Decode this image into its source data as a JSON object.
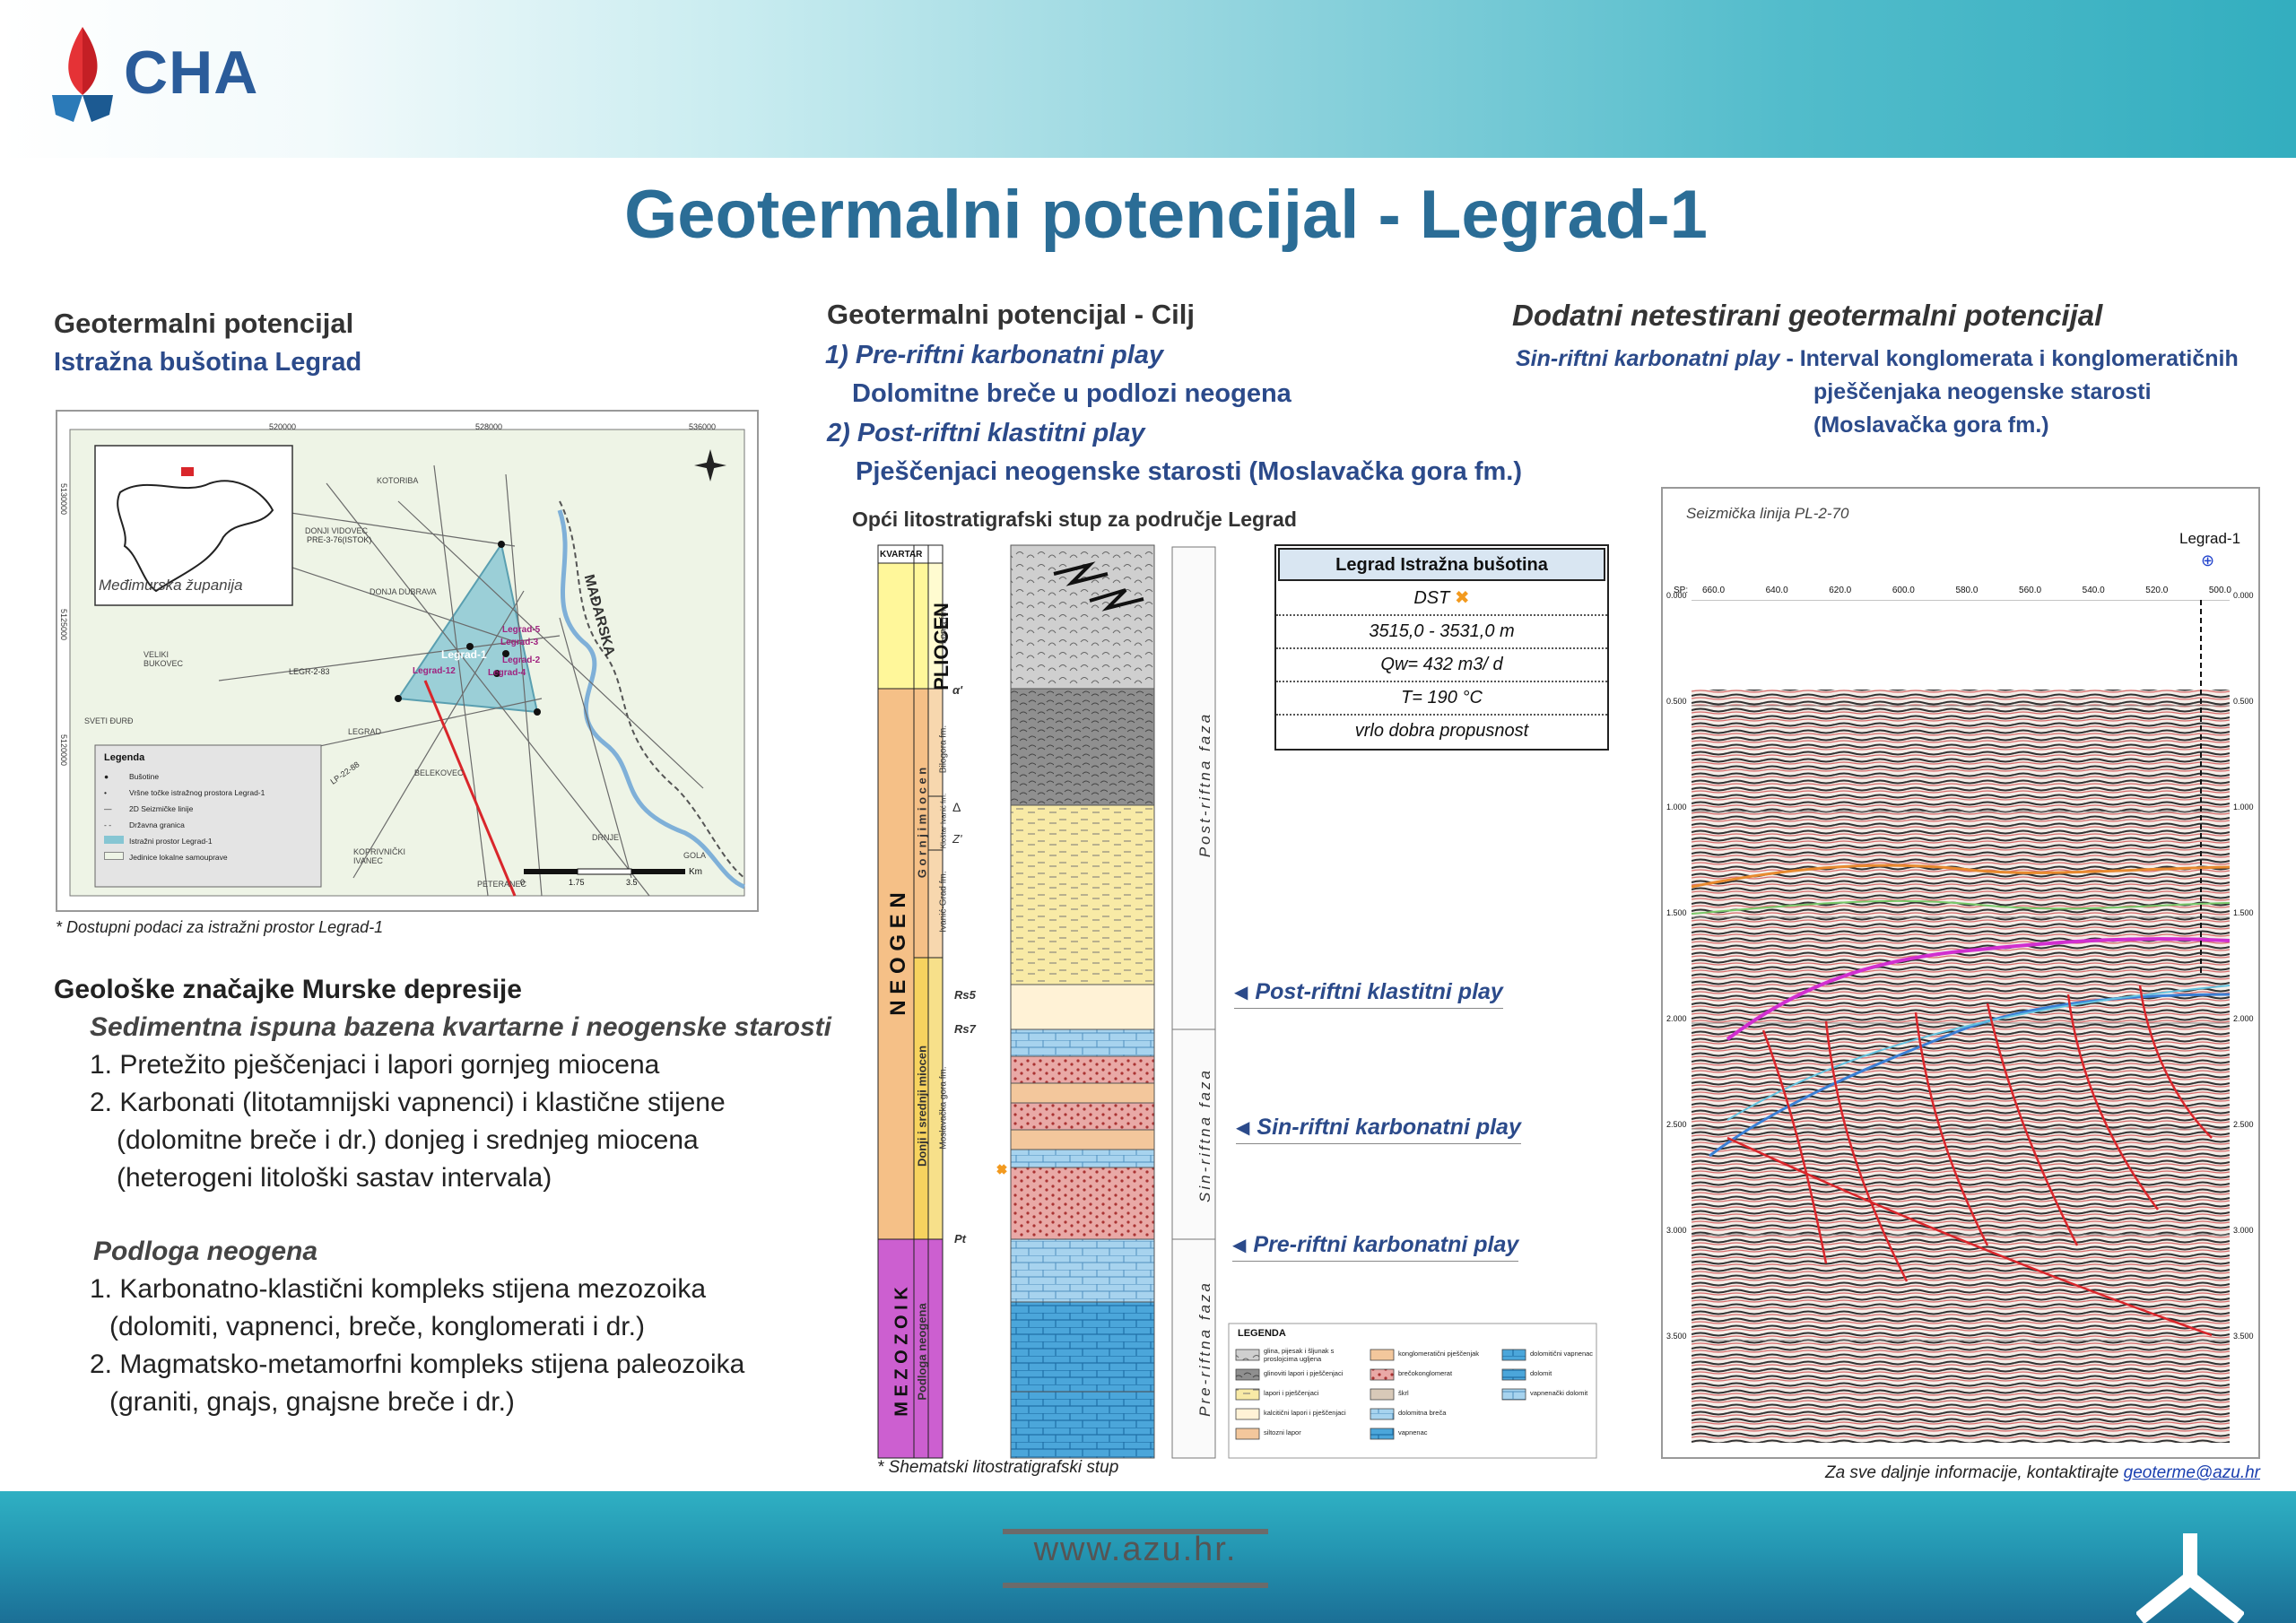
{
  "brand": {
    "logo_text": "CHA"
  },
  "title": "Geotermalni potencijal - Legrad-1",
  "left": {
    "heading": "Geotermalni potencijal",
    "subheading": "Istražna bušotina Legrad",
    "map": {
      "region_label": "Međimurska županija",
      "country_label": "MAĐARSKA",
      "grid_top": [
        "520000",
        "528000",
        "536000"
      ],
      "grid_side": [
        "5130000",
        "5125000",
        "5120000"
      ],
      "places": [
        "DONJI VIDOVEC",
        "KOTORIBA",
        "DONJA DUBRAVA",
        "VELIKI BUKOVEC",
        "SVETI ĐURĐ",
        "LEGRAD",
        "BELEKOVEC",
        "KOPRIVNIČKI IVANEC",
        "DRNJE",
        "PETERANEC",
        "GOLA"
      ],
      "wells": [
        "Legrad-1",
        "Legrad-2",
        "Legrad-3",
        "Legrad-4",
        "Legrad-5",
        "Legrad-12"
      ],
      "lines": [
        "PRE-3-76(ISTOK)",
        "LEGR-2-83",
        "LP-22-88"
      ],
      "scale": [
        "0",
        "1.75",
        "3.5",
        "Km"
      ],
      "legend_title": "Legenda",
      "legend_items": [
        "Bušotine",
        "Vršne točke istražnog prostora Legrad-1",
        "2D Seizmičke linije",
        "Državna granica",
        "Istražni prostor Legrad-1",
        "Jedinice lokalne samouprave"
      ]
    },
    "map_caption": "* Dostupni podaci za istražni prostor Legrad-1",
    "geo_title": "Geološke značajke Murske depresije",
    "geo_sub1": "Sedimentna ispuna bazena kvartarne i neogenske starosti",
    "geo_items1": [
      "1. Pretežito pješčenjaci i lapori gornjeg miocena",
      "2. Karbonati (litotamnijski vapnenci) i klastične stijene",
      "(dolomitne breče i dr.) donjeg i srednjeg miocena",
      "(heterogeni litološki sastav intervala)"
    ],
    "geo_sub2": "Podloga neogena",
    "geo_items2": [
      "1. Karbonatno-klastični kompleks stijena mezozoika",
      "(dolomiti, vapnenci, breče, konglomerati i dr.)",
      "2. Magmatsko-metamorfni kompleks stijena paleozoika",
      "(graniti, gnajs, gnajsne breče i dr.)"
    ]
  },
  "middle": {
    "heading": "Geotermalni potencijal - Cilj",
    "play1": "1) Pre-riftni karbonatni play",
    "play1_desc": "Dolomitne breče u podlozi neogena",
    "play2": "2) Post-riftni klastitni play",
    "play2_desc": "Pješčenjaci neogenske starosti (Moslavačka gora fm.)",
    "column_title": "Opći litostratigrafski stup za područje Legrad",
    "column_caption": "* Shematski litostratigrafski stup",
    "strat": {
      "era_kvartar": "KVARTAR",
      "era_pliocen": "PLIOCEN",
      "era_neogen": "N E O G E N",
      "era_mezozoik": "M E Z O Z O I K",
      "sub_gornji": "G o r n j i   m i o c e n",
      "sub_donji": "Donji i srednji miocen",
      "sub_podloga": "Podloga neogena",
      "fm_lonja": "Lonja fm.",
      "fm_bilogora": "Bilogora fm.",
      "fm_kloštar": "Kloštar Ivanić fm.",
      "fm_ivanic": "Ivanić-Grad fm.",
      "fm_moslavacka": "Moslavačka gora fm.",
      "markers": [
        "α'",
        "Δ",
        "Z'",
        "Rs5",
        "Rs7",
        "Pt"
      ],
      "faza_post": "Post-riftna faza",
      "faza_sin": "Sin-riftna faza",
      "faza_pre": "Pre-riftna faza"
    },
    "dst": {
      "title": "Legrad Istražna bušotina",
      "dst_label": "DST",
      "interval": "3515,0 - 3531,0 m",
      "flow": "Qw= 432 m3/ d",
      "temp": "T= 190 °C",
      "perm": "vrlo dobra propusnost"
    },
    "play_labels": {
      "post": "Post-riftni klastitni play",
      "sin": "Sin-riftni karbonatni play",
      "pre": "Pre-riftni karbonatni play"
    },
    "legend": {
      "title": "LEGENDA",
      "items": [
        "glina, pijesak i šljunak s proslojcima ugljena",
        "glinoviti lapori i pješčenjaci",
        "lapori i pješčenjaci",
        "kalcitični lapori i pješčenjaci",
        "siltozni lapor",
        "konglomeratični pješčenjak",
        "brečokonglomerat",
        "škrl",
        "dolomitna breča",
        "vapnenac",
        "dolomitični vapnenac",
        "dolomit",
        "vapnenački dolomit"
      ]
    }
  },
  "right": {
    "heading": "Dodatni netestirani geotermalni potencijal",
    "play_title": "Sin-riftni karbonatni play",
    "play_desc1": "- Interval konglomerata i konglomeratičnih",
    "play_desc2": "pješčenjaka neogenske starosti",
    "play_desc3": "(Moslavačka gora fm.)",
    "seismic": {
      "title": "Seizmička linija PL-2-70",
      "well": "Legrad-1",
      "sp_label": "SP:",
      "sp_values": [
        "660.0",
        "640.0",
        "620.0",
        "600.0",
        "580.0",
        "560.0",
        "540.0",
        "520.0",
        "500.0"
      ],
      "time_values": [
        "0.000",
        "0.500",
        "1.000",
        "1.500",
        "2.000",
        "2.500",
        "3.000",
        "3.500"
      ]
    },
    "contact_text": "Za sve daljnje informacije, kontaktirajte",
    "contact_email": "geoterme@azu.hr"
  },
  "footer": {
    "url": "www.azu.hr."
  },
  "colors": {
    "title": "#2b6d96",
    "blue_text": "#2b4a8a",
    "header_teal": "#33aebf",
    "footer_teal": "#2496b2",
    "play_red": "#d9262b"
  }
}
